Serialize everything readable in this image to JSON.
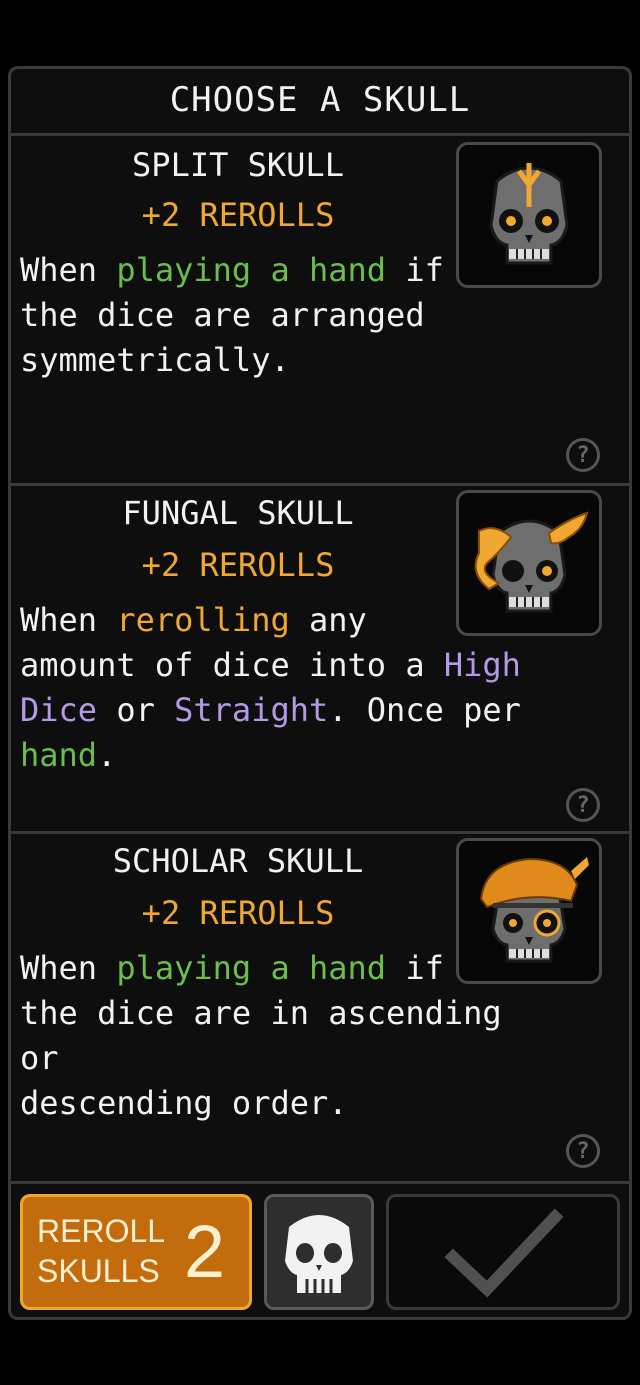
{
  "header": {
    "title": "CHOOSE A SKULL"
  },
  "cards": [
    {
      "name": "SPLIT SKULL",
      "bonus": "+2 REROLLS",
      "desc_parts": [
        {
          "text": "When ",
          "hl": ""
        },
        {
          "text": "playing a hand",
          "hl": "green"
        },
        {
          "text": " if\nthe dice are arranged\nsymmetrically.",
          "hl": ""
        }
      ],
      "icon": "split-skull-icon"
    },
    {
      "name": "FUNGAL SKULL",
      "bonus": "+2 REROLLS",
      "desc_parts": [
        {
          "text": "When ",
          "hl": ""
        },
        {
          "text": "rerolling",
          "hl": "orange"
        },
        {
          "text": " any\namount of dice into a ",
          "hl": ""
        },
        {
          "text": "High\nDice",
          "hl": "purple"
        },
        {
          "text": " or ",
          "hl": ""
        },
        {
          "text": "Straight",
          "hl": "purple"
        },
        {
          "text": ". Once per\n",
          "hl": ""
        },
        {
          "text": "hand",
          "hl": "green"
        },
        {
          "text": ".",
          "hl": ""
        }
      ],
      "icon": "fungal-skull-icon"
    },
    {
      "name": "SCHOLAR SKULL",
      "bonus": "+2 REROLLS",
      "desc_parts": [
        {
          "text": "When ",
          "hl": ""
        },
        {
          "text": "playing a hand",
          "hl": "green"
        },
        {
          "text": " if\nthe dice are in ascending or\ndescending order.",
          "hl": ""
        }
      ],
      "icon": "scholar-skull-icon"
    }
  ],
  "help_glyph": "?",
  "footer": {
    "reroll_label_line1": "REROLL",
    "reroll_label_line2": "SKULLS",
    "reroll_count": "2",
    "skull_button_icon": "skull-icon",
    "confirm_icon": "checkmark-icon"
  },
  "colors": {
    "accent_orange": "#f0a830",
    "green": "#6abe4c",
    "purple": "#b49ae6",
    "button_orange": "#c36c0d"
  }
}
